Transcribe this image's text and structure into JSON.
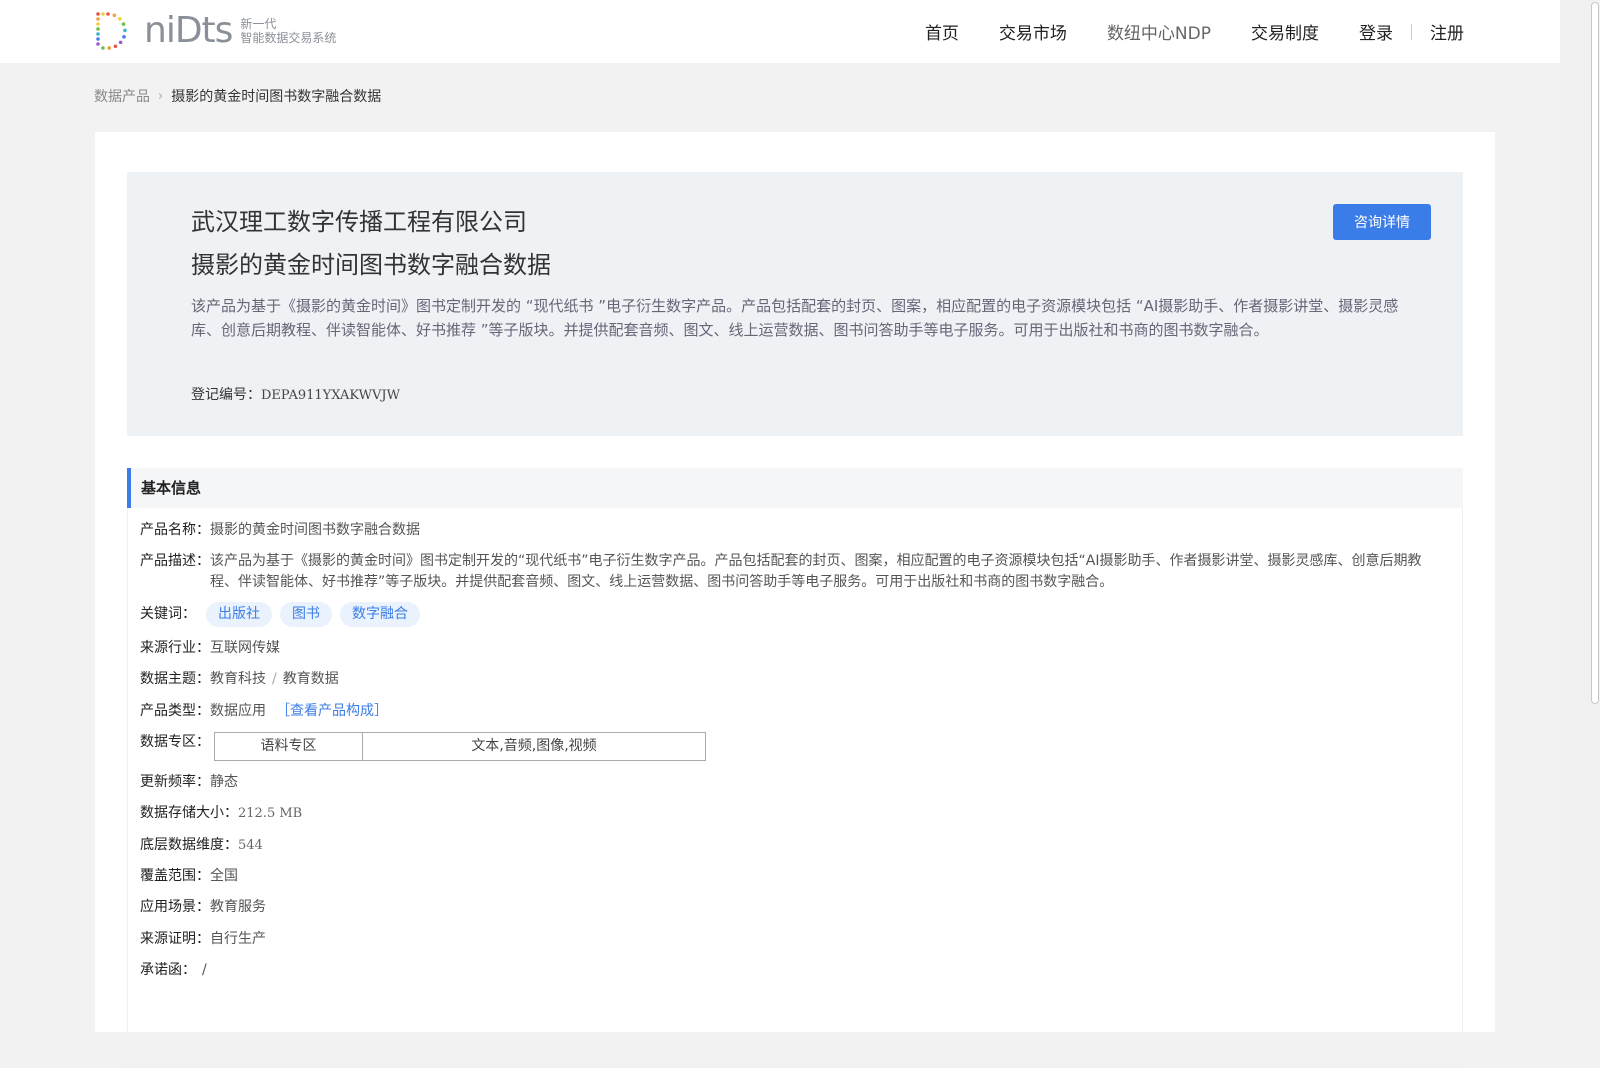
{
  "header": {
    "logo_text": "niDts",
    "logo_tagline_1": "新一代",
    "logo_tagline_2": "智能数据交易系统",
    "nav": [
      "首页",
      "交易市场",
      "数纽中心NDP",
      "交易制度"
    ],
    "login": "登录",
    "register": "注册"
  },
  "breadcrumb": {
    "root": "数据产品",
    "current": "摄影的黄金时间图书数字融合数据"
  },
  "hero": {
    "company": "武汉理工数字传播工程有限公司",
    "product": "摄影的黄金时间图书数字融合数据",
    "description": "该产品为基于《摄影的黄金时间》图书定制开发的 “现代纸书 ”电子衍生数字产品。产品包括配套的封页、图案，相应配置的电子资源模块包括 “AI摄影助手、作者摄影讲堂、摄影灵感库、创意后期教程、伴读智能体、好书推荐 ”等子版块。并提供配套音频、图文、线上运营数据、图书问答助手等电子服务。可用于出版社和书商的图书数字融合。",
    "reg_label": "登记编号：",
    "reg_value": "DEPA911YXAKWVJW",
    "consult_button": "咨询详情"
  },
  "basic_info": {
    "title": "基本信息",
    "name_label": "产品名称：",
    "name_value": "摄影的黄金时间图书数字融合数据",
    "desc_label": "产品描述：",
    "desc_value": "该产品为基于《摄影的黄金时间》图书定制开发的“现代纸书”电子衍生数字产品。产品包括配套的封页、图案，相应配置的电子资源模块包括“AI摄影助手、作者摄影讲堂、摄影灵感库、创意后期教程、伴读智能体、好书推荐”等子版块。并提供配套音频、图文、线上运营数据、图书问答助手等电子服务。可用于出版社和书商的图书数字融合。",
    "keywords_label": "关键词：",
    "keywords": [
      "出版社",
      "图书",
      "数字融合"
    ],
    "industry_label": "来源行业：",
    "industry_value": "互联网传媒",
    "theme_label": "数据主题：",
    "theme_1": "教育科技",
    "theme_sep": "/",
    "theme_2": "教育数据",
    "type_label": "产品类型：",
    "type_value": "数据应用",
    "type_link": "［查看产品构成］",
    "zone_label": "数据专区：",
    "zone_name": "语料专区",
    "zone_types": "文本,音频,图像,视频",
    "freq_label": "更新频率：",
    "freq_value": "静态",
    "size_label": "数据存储大小：",
    "size_value": "212.5 MB",
    "dim_label": "底层数据维度：",
    "dim_value": "544",
    "coverage_label": "覆盖范围：",
    "coverage_value": "全国",
    "scenario_label": "应用场景：",
    "scenario_value": "教育服务",
    "source_label": "来源证明：",
    "source_value": "自行生产",
    "commit_label": "承诺函：",
    "commit_value": "/"
  }
}
